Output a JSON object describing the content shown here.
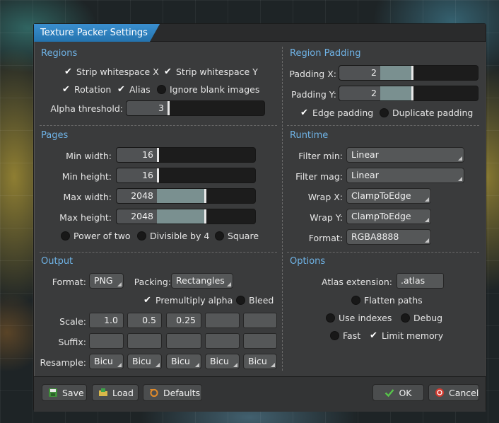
{
  "window": {
    "title": "Texture Packer Settings"
  },
  "regions": {
    "title": "Regions",
    "strip_x": "Strip whitespace X",
    "strip_y": "Strip whitespace Y",
    "rotation": "Rotation",
    "alias": "Alias",
    "ignore_blank": "Ignore blank images",
    "alpha_label": "Alpha threshold:",
    "alpha_value": "3",
    "checked": {
      "strip_x": true,
      "strip_y": true,
      "rotation": true,
      "alias": true,
      "ignore_blank": false
    }
  },
  "padding": {
    "title": "Region Padding",
    "x_label": "Padding X:",
    "x_value": "2",
    "y_label": "Padding Y:",
    "y_value": "2",
    "edge": "Edge padding",
    "duplicate": "Duplicate padding",
    "checked": {
      "edge": true,
      "duplicate": false
    }
  },
  "pages": {
    "title": "Pages",
    "min_width_label": "Min width:",
    "min_width": "16",
    "min_height_label": "Min height:",
    "min_height": "16",
    "max_width_label": "Max width:",
    "max_width": "2048",
    "max_height_label": "Max height:",
    "max_height": "2048",
    "power_of_two": "Power of two",
    "divisible": "Divisible by 4",
    "square": "Square",
    "checked": {
      "power_of_two": false,
      "divisible": false,
      "square": false
    }
  },
  "runtime": {
    "title": "Runtime",
    "filter_min_label": "Filter min:",
    "filter_min": "Linear",
    "filter_mag_label": "Filter mag:",
    "filter_mag": "Linear",
    "wrap_x_label": "Wrap X:",
    "wrap_x": "ClampToEdge",
    "wrap_y_label": "Wrap Y:",
    "wrap_y": "ClampToEdge",
    "format_label": "Format:",
    "format": "RGBA8888"
  },
  "output": {
    "title": "Output",
    "format_label": "Format:",
    "format": "PNG",
    "packing_label": "Packing:",
    "packing": "Rectangles",
    "premultiply": "Premultiply alpha",
    "bleed": "Bleed",
    "checked": {
      "premultiply": true,
      "bleed": false
    },
    "scale_label": "Scale:",
    "scales": [
      "1.0",
      "0.5",
      "0.25",
      "",
      ""
    ],
    "suffix_label": "Suffix:",
    "suffixes": [
      "",
      "",
      "",
      "",
      ""
    ],
    "resample_label": "Resample:",
    "resamples": [
      "Bicu",
      "Bicu",
      "Bicu",
      "Bicu",
      "Bicu"
    ]
  },
  "options": {
    "title": "Options",
    "atlas_label": "Atlas extension:",
    "atlas_value": ".atlas",
    "flatten": "Flatten paths",
    "use_indexes": "Use indexes",
    "debug": "Debug",
    "fast": "Fast",
    "limit_memory": "Limit memory",
    "checked": {
      "flatten": false,
      "use_indexes": false,
      "debug": false,
      "fast": false,
      "limit_memory": true
    }
  },
  "footer": {
    "save": "Save",
    "load": "Load",
    "defaults": "Defaults",
    "ok": "OK",
    "cancel": "Cancel"
  },
  "colors": {
    "accent": "#6fb3e6",
    "title_tab": "#2f86c7",
    "slider_fill": "#7a9090"
  },
  "check_glyph": "✔"
}
